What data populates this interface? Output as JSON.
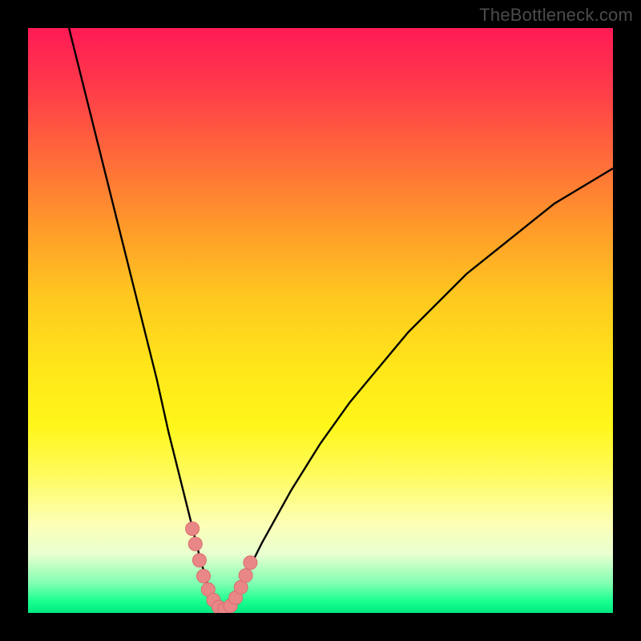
{
  "watermark": "TheBottleneck.com",
  "colors": {
    "frame": "#000000",
    "curve": "#000000",
    "marker_fill": "#e98787",
    "marker_stroke": "#d86e6e"
  },
  "chart_data": {
    "type": "line",
    "title": "",
    "xlabel": "",
    "ylabel": "",
    "xlim": [
      0,
      100
    ],
    "ylim": [
      0,
      100
    ],
    "note": "V-shaped bottleneck curve; y≈0 means balanced (green), y→100 means severe bottleneck (red). Minimum near x≈33.",
    "series": [
      {
        "name": "bottleneck-curve",
        "x": [
          7,
          10,
          13,
          16,
          19,
          22,
          24,
          26,
          28,
          29.5,
          31,
          32,
          33,
          34,
          35.5,
          37,
          40,
          45,
          50,
          55,
          60,
          65,
          70,
          75,
          80,
          85,
          90,
          95,
          100
        ],
        "y": [
          100,
          88,
          76,
          64,
          52,
          40,
          31,
          23,
          15,
          9,
          4,
          1.5,
          0.5,
          1,
          3,
          6,
          12,
          21,
          29,
          36,
          42,
          48,
          53,
          58,
          62,
          66,
          70,
          73,
          76
        ]
      }
    ],
    "markers": {
      "name": "highlighted-points",
      "x": [
        28.1,
        28.6,
        29.3,
        30.0,
        30.8,
        31.7,
        32.6,
        33.6,
        34.6,
        35.5,
        36.4,
        37.2,
        38.0
      ],
      "y": [
        14.4,
        11.8,
        9.0,
        6.3,
        4.0,
        2.2,
        1.0,
        0.6,
        1.2,
        2.6,
        4.4,
        6.4,
        8.6
      ]
    }
  }
}
